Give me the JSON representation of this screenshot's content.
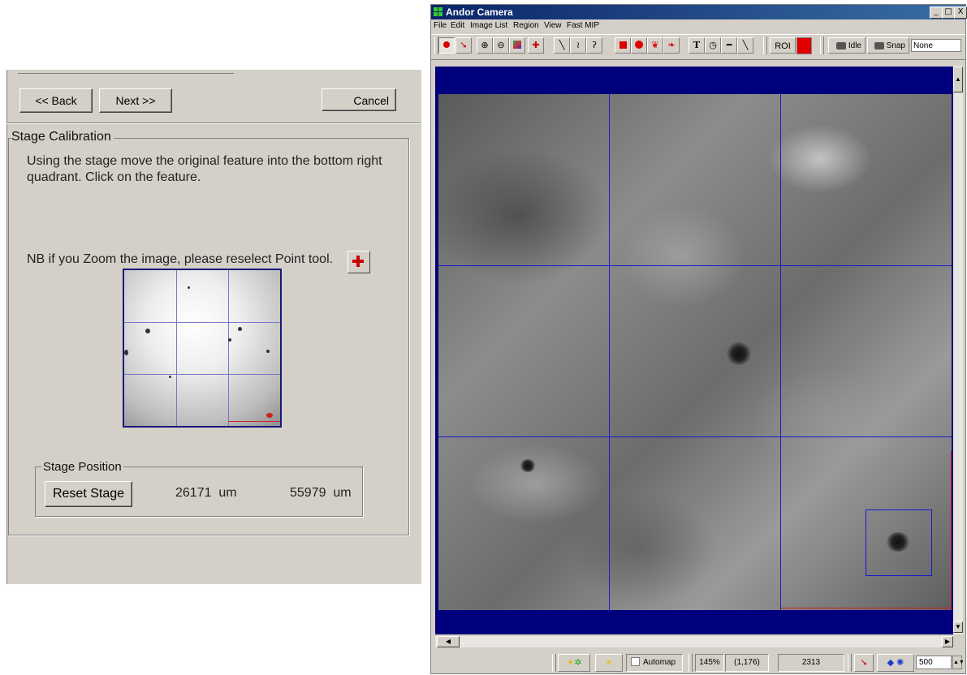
{
  "wizard": {
    "back_label": "<< Back",
    "next_label": "Next >>",
    "cancel_label": "Cancel",
    "section_title": "Stage Calibration",
    "instruction": "Using the stage move the original feature into the bottom right quadrant. Click on the feature.",
    "note": "NB if you Zoom the image, please reselect Point tool.",
    "stage_position": {
      "title": "Stage Position",
      "reset_label": "Reset Stage",
      "x_value": "26171  um",
      "y_value": "55979  um"
    }
  },
  "andor": {
    "window_title": "Andor Camera",
    "window_controls": [
      "_",
      "□",
      "X"
    ],
    "menu": [
      "File",
      "Edit",
      "Image List",
      "Region",
      "View",
      "Fast MIP"
    ],
    "toolbar": {
      "roi_label": "ROI",
      "roi_color": "#e00000",
      "idle_label": "Idle",
      "snap_label": "Snap",
      "mode_value": "None"
    },
    "status": {
      "automap_label": "Automap",
      "zoom": "145%",
      "coords": "(1,176)",
      "value": "2313",
      "bin_value": "500"
    }
  },
  "colors": {
    "dialog_bg": "#d4d0c8",
    "title_bar": "#0a246a",
    "viewport_bg": "#00007d",
    "grid_line": "#1a1acc",
    "accent_red": "#dd0000"
  }
}
